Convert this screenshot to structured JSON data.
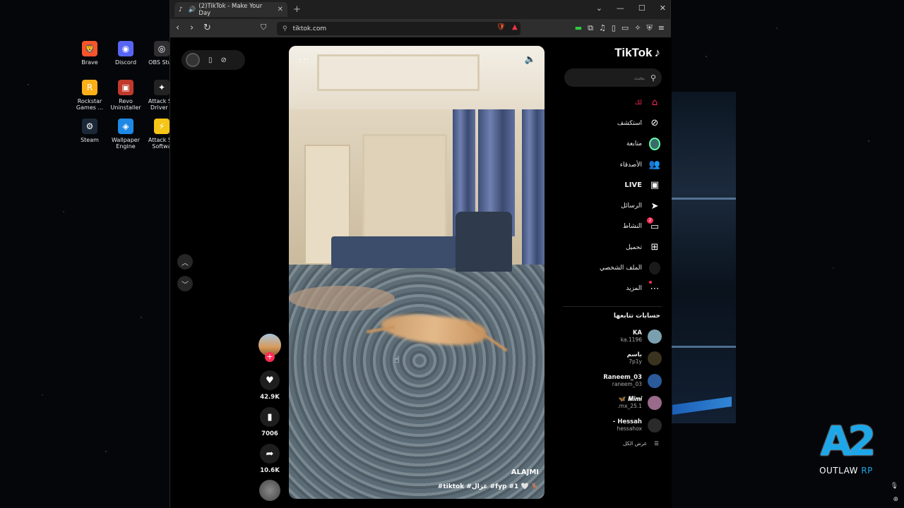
{
  "desktop": {
    "icons": [
      {
        "label": "Brave",
        "icon": "brave-icon",
        "color": "#fb542b",
        "glyph": "🦁"
      },
      {
        "label": "Discord",
        "icon": "discord-icon",
        "color": "#5865f2",
        "glyph": "◉"
      },
      {
        "label": "OBS Stud",
        "icon": "obs-icon",
        "color": "#302e31",
        "glyph": "◎"
      },
      {
        "label": "Rockstar Games ...",
        "icon": "rockstar-icon",
        "color": "#fcaf17",
        "glyph": "R"
      },
      {
        "label": "Revo Uninstaller",
        "icon": "revo-icon",
        "color": "#c0392b",
        "glyph": "▣"
      },
      {
        "label": "Attack Sh Driver v",
        "icon": "attack-shark-driver-icon",
        "color": "#222222",
        "glyph": "✦"
      },
      {
        "label": "Steam",
        "icon": "steam-icon",
        "color": "#1b2838",
        "glyph": "⚙"
      },
      {
        "label": "Wallpaper Engine",
        "icon": "wallpaper-engine-icon",
        "color": "#1e88e5",
        "glyph": "◈"
      },
      {
        "label": "Attack Sh Softwa",
        "icon": "attack-shark-software-icon",
        "color": "#f5c518",
        "glyph": "⚡"
      }
    ]
  },
  "browser": {
    "tab_title": "(2)TikTok - Make Your Day",
    "url": "tiktok.com",
    "tab_favicon": "tiktok-icon"
  },
  "video": {
    "author": "ALAJMI",
    "caption": "#tiktok #غزال #fyp #1 🤍 🦌",
    "likes": "42.9K",
    "saves": "7006",
    "shares": "10.6K"
  },
  "sidebar": {
    "logo": "TikTok",
    "search_placeholder": "بحث",
    "nav": [
      {
        "label": "لك",
        "icon": "home-icon",
        "glyph": "⌂",
        "active": true
      },
      {
        "label": "استكشف",
        "icon": "compass-icon",
        "glyph": "⊘"
      },
      {
        "label": "متابعة",
        "icon": "following-avatar-icon",
        "glyph": ""
      },
      {
        "label": "الأصدقاء",
        "icon": "friends-icon",
        "glyph": "👥"
      },
      {
        "label": "LIVE",
        "icon": "live-icon",
        "glyph": "▣"
      },
      {
        "label": "الرسائل",
        "icon": "messages-icon",
        "glyph": "➤"
      },
      {
        "label": "النشاط",
        "icon": "activity-icon",
        "glyph": "▭",
        "badge": "2"
      },
      {
        "label": "تحميل",
        "icon": "upload-icon",
        "glyph": "⊞"
      },
      {
        "label": "الملف الشخصي",
        "icon": "profile-avatar-icon",
        "glyph": ""
      },
      {
        "label": "المزيد",
        "icon": "more-icon",
        "glyph": "⋯"
      }
    ],
    "following_title": "حسابات تتابعها",
    "following": [
      {
        "name": "KA",
        "handle": "ka.1196",
        "color": "#7aa0b0"
      },
      {
        "name": "باسم",
        "handle": "7p1y",
        "color": "#3a3320"
      },
      {
        "name": "Raneem_03",
        "handle": "raneem_03",
        "color": "#2a5a9a"
      },
      {
        "name": "𝑴𝒊𝒎𝒊 🦋",
        "handle": "mx_25.1.",
        "color": "#9a6a8a"
      },
      {
        "name": "Hessah -",
        "handle": "hessahox",
        "color": "#2a2a2a"
      }
    ],
    "see_all": "عرض الكل"
  },
  "watermark": {
    "brand": "OUTLAW",
    "suffix": "RP",
    "mark": "A2"
  }
}
